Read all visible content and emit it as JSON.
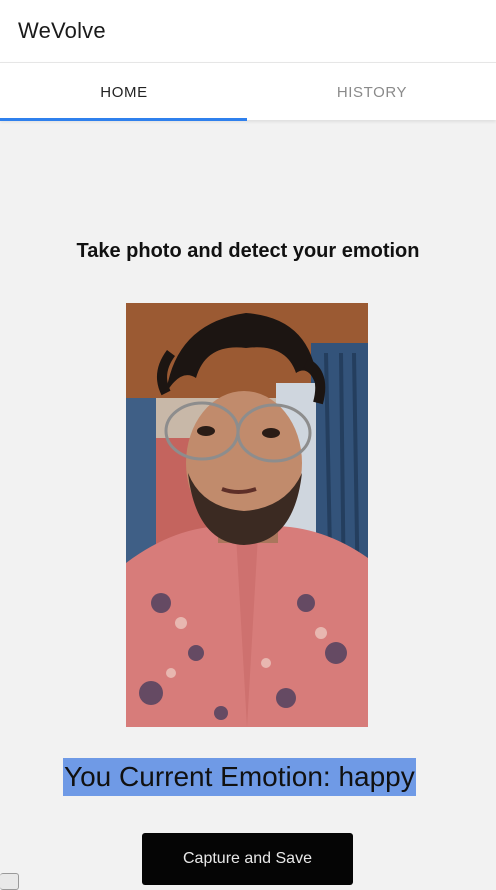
{
  "app": {
    "title": "WeVolve"
  },
  "tabs": [
    {
      "label": "HOME",
      "active": true
    },
    {
      "label": "HISTORY",
      "active": false
    }
  ],
  "colors": {
    "accent": "#2f80ed",
    "highlight": "#6f9ae6",
    "button_bg": "#050505"
  },
  "main": {
    "heading": "Take photo and detect your emotion",
    "emotion_label": "You Current Emotion: ",
    "emotion_value": "happy",
    "capture_button_label": "Capture and Save"
  }
}
